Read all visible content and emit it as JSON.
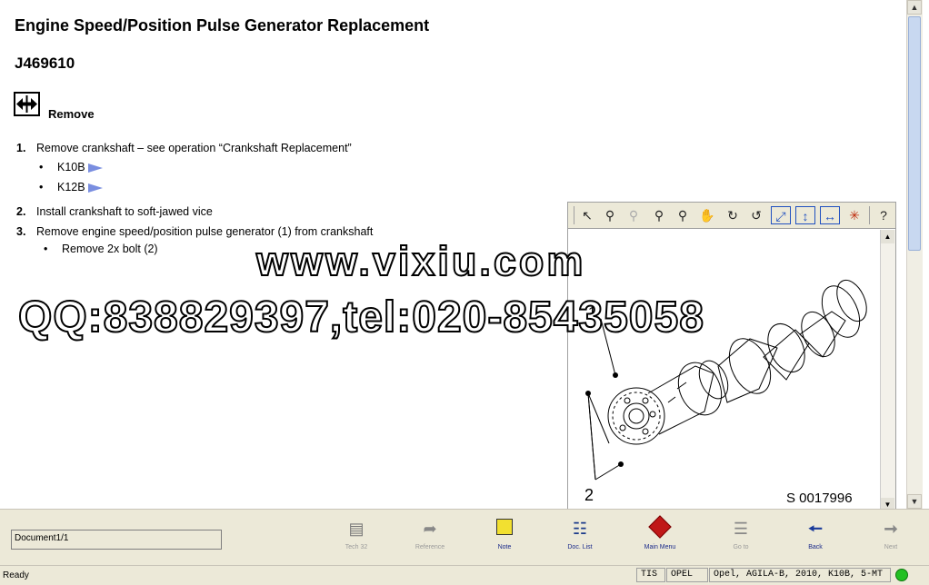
{
  "document": {
    "title": "Engine Speed/Position Pulse Generator Replacement",
    "job_number": "J469610",
    "section_label": "Remove",
    "steps": [
      {
        "num": "1.",
        "text": "Remove crankshaft  –  see operation “Crankshaft Replacement”"
      },
      {
        "num": "2.",
        "text": "Install crankshaft to soft-jawed vice"
      },
      {
        "num": "3.",
        "text": "Remove engine speed/position pulse generator (1) from crankshaft"
      }
    ],
    "step1_bullets": [
      "K10B",
      "K12B"
    ],
    "step3_bullets": [
      "Remove 2x bolt (2)"
    ],
    "bullet_char": "•"
  },
  "watermark": {
    "line1": "www.vixiu.com",
    "line2": "QQ:838829397,tel:020-85435058"
  },
  "viewer": {
    "label_1": "1",
    "label_2": "2",
    "reference": "S 0017996",
    "toolbar_icons": [
      "pointer-icon",
      "zoom-in-icon",
      "zoom-out-icon",
      "zoom-icon",
      "zoom-area-icon",
      "pan-hand-icon",
      "rotate-right-icon",
      "rotate-left-icon",
      "fit-page-icon",
      "fit-height-icon",
      "fit-width-icon",
      "hotspot-icon",
      "help-icon"
    ]
  },
  "bottom_toolbar": {
    "document_box": "Document1/1",
    "buttons": [
      {
        "label": "Tech 32",
        "icon": "tech32-icon",
        "enabled": false
      },
      {
        "label": "Reference",
        "icon": "reference-icon",
        "enabled": false
      },
      {
        "label": "Note",
        "icon": "note-icon",
        "enabled": true
      },
      {
        "label": "Doc. List",
        "icon": "doc-list-icon",
        "enabled": true
      },
      {
        "label": "Main Menu",
        "icon": "main-menu-icon",
        "enabled": true
      },
      {
        "label": "Go to",
        "icon": "goto-icon",
        "enabled": false
      },
      {
        "label": "Back",
        "icon": "back-icon",
        "enabled": true
      },
      {
        "label": "Next",
        "icon": "next-icon",
        "enabled": false
      }
    ]
  },
  "status_bar": {
    "ready": "Ready",
    "mode": "TIS",
    "make": "OPEL",
    "vehicle": "Opel, AGILA-B, 2010, K10B, 5-MT",
    "status_color": "#22c022"
  }
}
